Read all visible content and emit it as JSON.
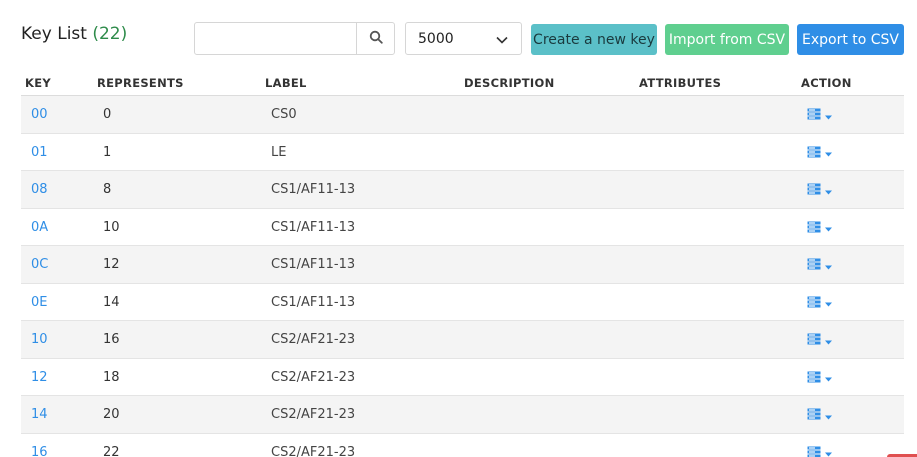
{
  "header": {
    "title": "Key List",
    "count": "(22)"
  },
  "search": {
    "value": "",
    "placeholder": "",
    "icon": "search-icon"
  },
  "page_size": {
    "selected": "5000"
  },
  "buttons": {
    "create": "Create a new key",
    "import": "Import from CSV",
    "export": "Export to CSV"
  },
  "colors": {
    "accent_link": "#2f8ee6",
    "create_button": "#5bc0c8",
    "import_button": "#5fcf8f",
    "export_button": "#2f8ee6",
    "count_green": "#2e8b4a"
  },
  "table": {
    "columns": {
      "key": "KEY",
      "represents": "REPRESENTS",
      "label": "LABEL",
      "description": "DESCRIPTION",
      "attributes": "ATTRIBUTES",
      "action": "ACTION"
    },
    "rows": [
      {
        "key": "00",
        "represents": "0",
        "label": "CS0",
        "description": "",
        "attributes": ""
      },
      {
        "key": "01",
        "represents": "1",
        "label": "LE",
        "description": "",
        "attributes": ""
      },
      {
        "key": "08",
        "represents": "8",
        "label": "CS1/AF11-13",
        "description": "",
        "attributes": ""
      },
      {
        "key": "0A",
        "represents": "10",
        "label": "CS1/AF11-13",
        "description": "",
        "attributes": ""
      },
      {
        "key": "0C",
        "represents": "12",
        "label": "CS1/AF11-13",
        "description": "",
        "attributes": ""
      },
      {
        "key": "0E",
        "represents": "14",
        "label": "CS1/AF11-13",
        "description": "",
        "attributes": ""
      },
      {
        "key": "10",
        "represents": "16",
        "label": "CS2/AF21-23",
        "description": "",
        "attributes": ""
      },
      {
        "key": "12",
        "represents": "18",
        "label": "CS2/AF21-23",
        "description": "",
        "attributes": ""
      },
      {
        "key": "14",
        "represents": "20",
        "label": "CS2/AF21-23",
        "description": "",
        "attributes": ""
      },
      {
        "key": "16",
        "represents": "22",
        "label": "CS2/AF21-23",
        "description": "",
        "attributes": ""
      }
    ],
    "action_icon": "server-menu-icon"
  }
}
